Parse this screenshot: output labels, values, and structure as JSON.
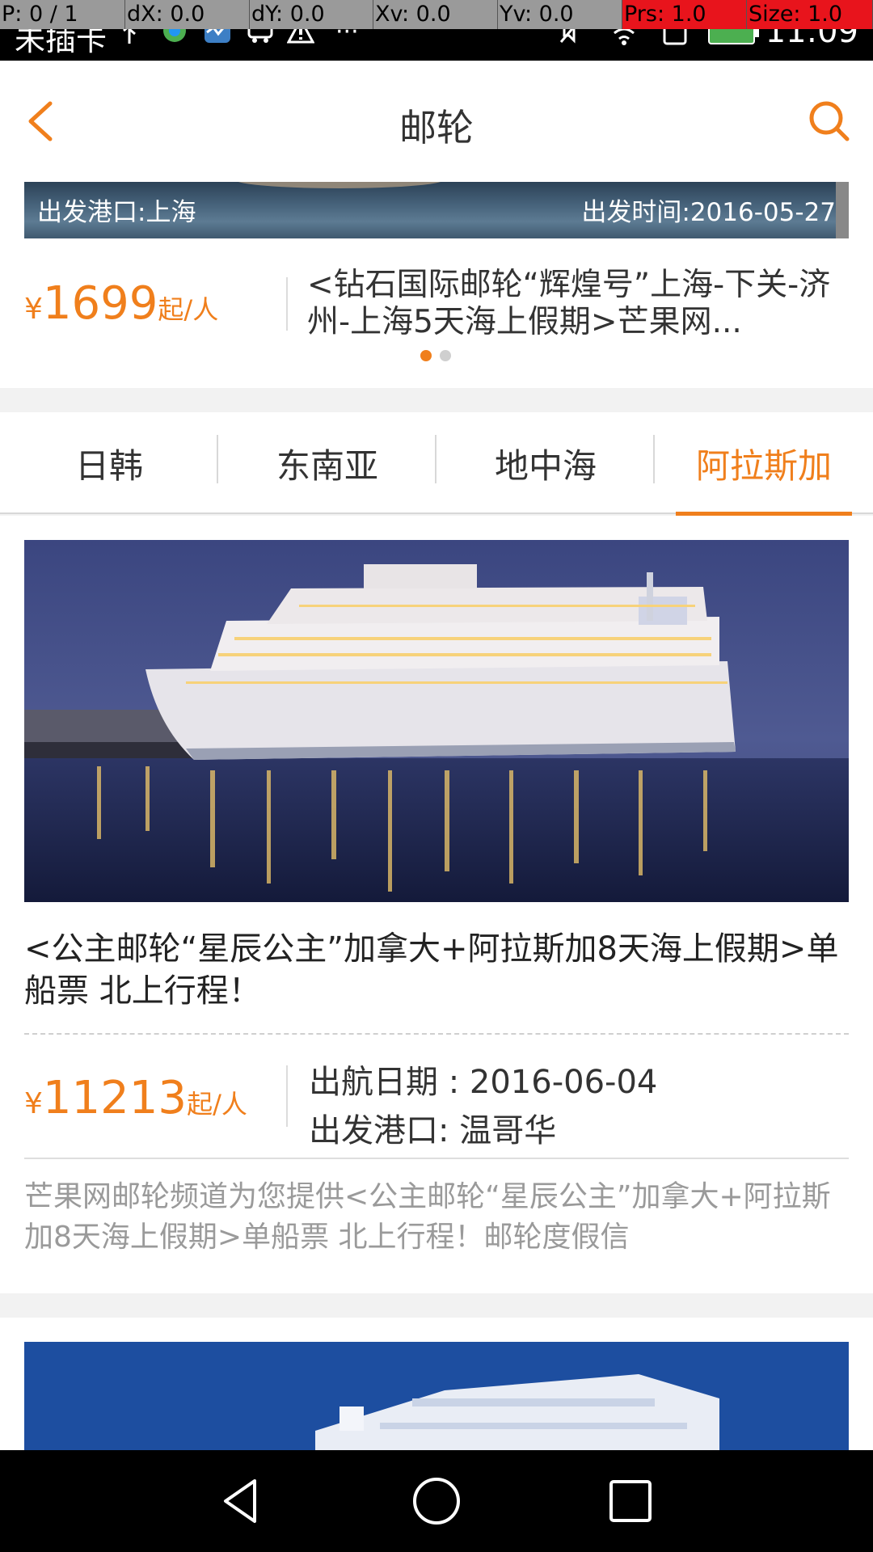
{
  "status_bar": {
    "debug": [
      {
        "text": "P: 0 / 1",
        "tone": "gray"
      },
      {
        "text": "dX: 0.0",
        "tone": "gray"
      },
      {
        "text": "dY: 0.0",
        "tone": "gray"
      },
      {
        "text": "Xv: 0.0",
        "tone": "gray"
      },
      {
        "text": "Yv: 0.0",
        "tone": "gray"
      },
      {
        "text": "Prs: 1.0",
        "tone": "red"
      },
      {
        "text": "Size: 1.0",
        "tone": "red"
      }
    ],
    "carrier": "未插卡",
    "overflow": "···",
    "time": "11:09"
  },
  "header": {
    "title": "邮轮",
    "back_icon": "chevron-left-icon",
    "search_icon": "search-icon"
  },
  "banner": {
    "port": "出发港口:上海",
    "date": "出发时间:2016-05-27",
    "currency": "¥",
    "price": "1699",
    "per": "起/人",
    "title": "<钻石国际邮轮“辉煌号”上海-下关-济州-上海5天海上假期>芒果网...",
    "page_count": 2,
    "active_page": 1
  },
  "tabs": [
    {
      "label": "日韩",
      "active": false
    },
    {
      "label": "东南亚",
      "active": false
    },
    {
      "label": "地中海",
      "active": false
    },
    {
      "label": "阿拉斯加",
      "active": true
    }
  ],
  "card": {
    "title": "<公主邮轮“星辰公主”加拿大+阿拉斯加8天海上假期>单船票 北上行程！",
    "currency": "¥",
    "price": "11213",
    "per": "起/人",
    "sail_date": "出航日期 : 2016-06-04",
    "depart_port": "出发港口:  温哥华",
    "description": "芒果网邮轮频道为您提供<公主邮轮“星辰公主”加拿大+阿拉斯加8天海上假期>单船票 北上行程！邮轮度假信"
  },
  "colors": {
    "accent": "#f07f1c",
    "text": "#333333",
    "muted": "#9a9a9a"
  },
  "nav_bar": {
    "back_icon": "triangle-back-icon",
    "home_icon": "circle-home-icon",
    "recents_icon": "square-recents-icon"
  }
}
